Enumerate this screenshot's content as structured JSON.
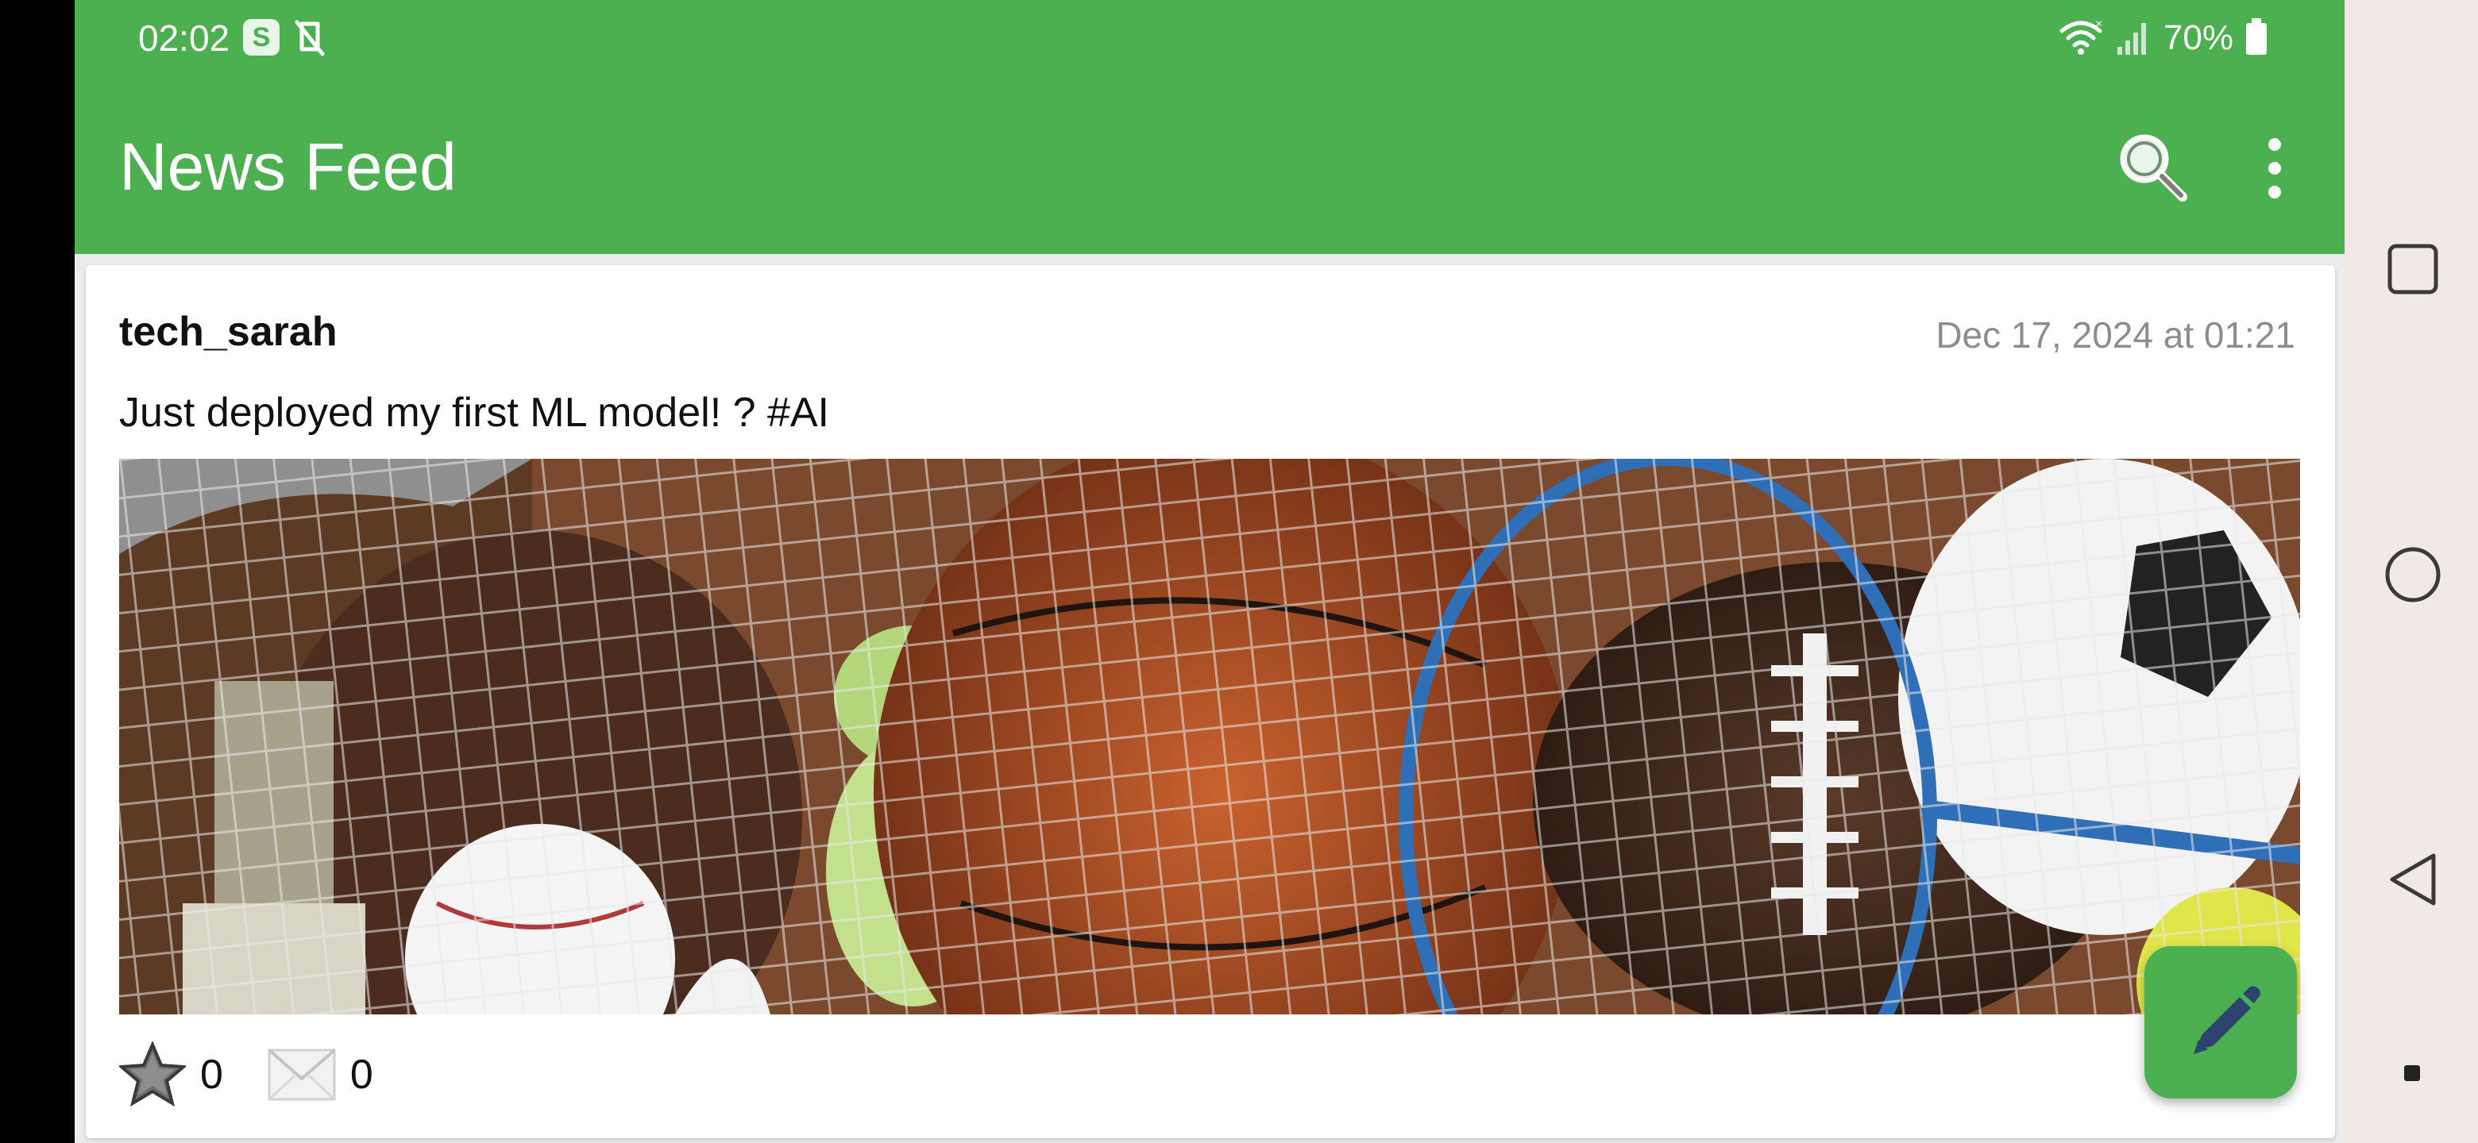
{
  "status_bar": {
    "time": "02:02",
    "battery_pct": "70%",
    "icons": [
      "skype-icon",
      "notifications-off-icon",
      "wifi-icon",
      "signal-icon",
      "battery-icon"
    ]
  },
  "app_bar": {
    "title": "News Feed",
    "actions": [
      "search-icon",
      "more-vert-icon"
    ]
  },
  "post": {
    "username": "tech_sarah",
    "date": "Dec 17, 2024 at 01:21",
    "text": "Just deployed my first ML model! ? #AI",
    "image_icon": "sports-equipment-photo",
    "likes": "0",
    "comments": "0"
  },
  "fab": {
    "icon": "pencil-icon"
  },
  "nav": {
    "items": [
      "recents-square-icon",
      "home-circle-icon",
      "back-triangle-icon",
      "dot-icon"
    ]
  },
  "colors": {
    "accent": "#4caf50",
    "background": "#ececec",
    "card": "#ffffff",
    "date": "#8d8d8d"
  }
}
